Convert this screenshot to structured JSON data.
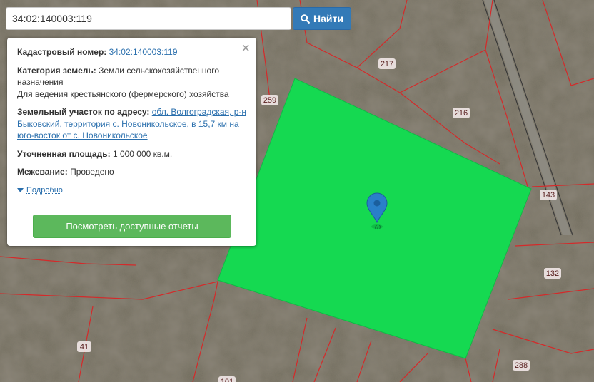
{
  "search": {
    "value": "34:02:140003:119",
    "button_label": "Найти"
  },
  "popup": {
    "cadastral_label": "Кадастровый номер:",
    "cadastral_value": "34:02:140003:119",
    "category_label": "Категория земель:",
    "category_value": "Земли сельскохозяйственного назначения",
    "category_use": "Для ведения крестьянского (фермерского) хозяйства",
    "address_label": "Земельный участок по адресу:",
    "address_value": "обл. Волгоградская, р-н Быковский, территория с. Новоникольское, в 15,7 км на юго-восток от с. Новоникольское",
    "area_label": "Уточненная площадь:",
    "area_value": "1 000 000 кв.м.",
    "survey_label": "Межевание:",
    "survey_value": "Проведено",
    "more_label": "Подробно",
    "report_button": "Посмотреть доступные отчеты"
  },
  "map": {
    "parcel_labels": [
      "217",
      "259",
      "216",
      "143",
      "132",
      "41",
      "288",
      "101"
    ],
    "selected_parcel_color": "#15d951",
    "boundary_color": "#d42a2a",
    "marker_color": "#2a7fc9"
  }
}
